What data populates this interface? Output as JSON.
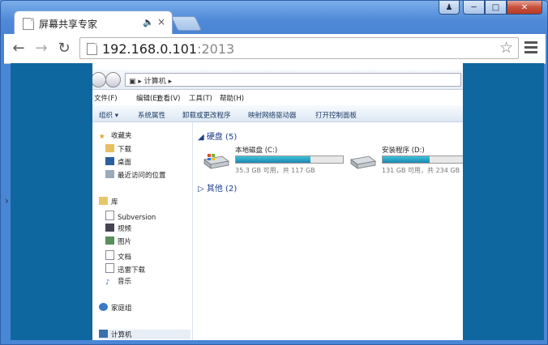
{
  "tab": {
    "title": "屏幕共享专家",
    "audio_icon": "speaker-icon",
    "close_glyph": "×"
  },
  "window_buttons": {
    "user": "user-icon",
    "minimize": "minimize-icon",
    "maximize": "maximize-icon",
    "close": "close-icon"
  },
  "address": {
    "host": "192.168.0.101",
    "port": ":2013"
  },
  "remote": {
    "breadcrumb": "计算机",
    "menu": [
      "文件(F)",
      "编辑(E)",
      "查看(V)",
      "工具(T)",
      "帮助(H)"
    ],
    "commands": [
      "组织 ▾",
      "系统属性",
      "卸载或更改程序",
      "映射网络驱动器",
      "打开控制面板"
    ],
    "nav": {
      "favorites": "收藏夹",
      "downloads": "下载",
      "desktop": "桌面",
      "recent": "最近访问的位置",
      "libraries": "库",
      "subversion": "Subversion",
      "videos": "视频",
      "pictures": "图片",
      "documents": "文档",
      "xunlei": "迅雷下载",
      "music": "音乐",
      "homegroup": "家庭组",
      "computer": "计算机"
    },
    "hard_disks_header": "硬盘 (5)",
    "others_header": "其他 (2)",
    "drives": [
      {
        "name": "本地磁盘 (C:)",
        "free": "35.3 GB 可用，共 117 GB",
        "used_fraction": 0.7
      },
      {
        "name": "安装程序 (D:)",
        "free": "131 GB 可用，共 234 GB",
        "used_fraction": 0.44
      }
    ]
  },
  "colors": {
    "remote_bg": "#0f67a0",
    "chrome_frame": "#4a86d6"
  }
}
